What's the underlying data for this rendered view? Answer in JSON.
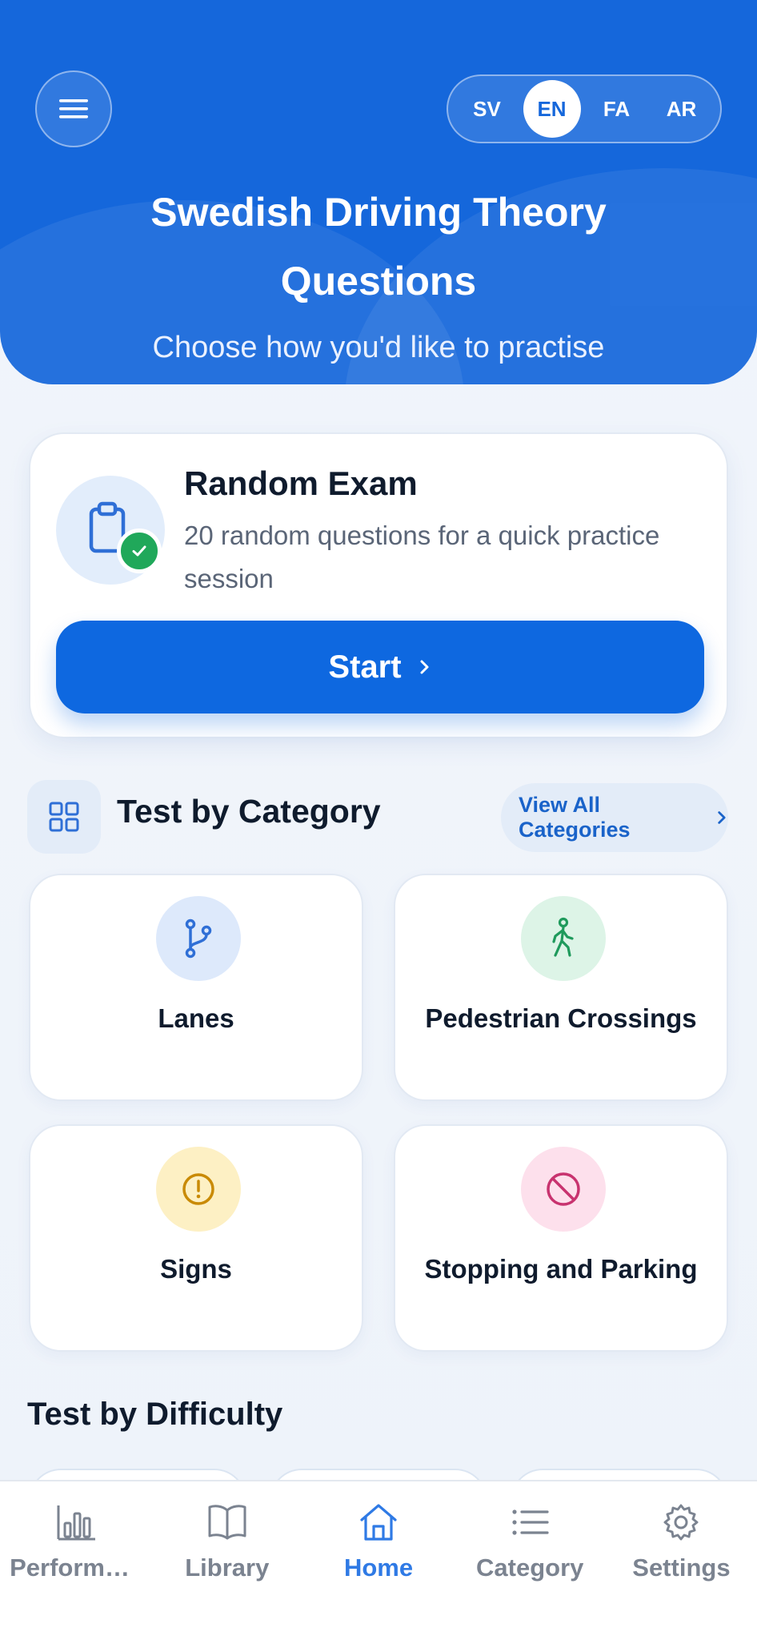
{
  "header": {
    "title_line1": "Swedish Driving Theory",
    "title_line2": "Questions",
    "subtitle": "Choose how you'd like to practise",
    "languages": [
      "SV",
      "EN",
      "FA",
      "AR"
    ],
    "active_language": "EN"
  },
  "exam": {
    "title": "Random Exam",
    "description": "20 random questions for a quick practice session",
    "start_label": "Start"
  },
  "categories": {
    "heading": "Test by Category",
    "view_all_label": "View All Categories",
    "items": [
      {
        "label": "Lanes",
        "icon": "lane-split-icon",
        "color": "#2f6fd6",
        "bg": "#dde9fb"
      },
      {
        "label": "Pedestrian Crossings",
        "icon": "pedestrian-icon",
        "color": "#1f9a5c",
        "bg": "#ddf4e7"
      },
      {
        "label": "Signs",
        "icon": "warning-icon",
        "color": "#c98a05",
        "bg": "#fdf0c4"
      },
      {
        "label": "Stopping and Parking",
        "icon": "no-entry-icon",
        "color": "#c8336f",
        "bg": "#fde0ec"
      }
    ]
  },
  "difficulty": {
    "heading": "Test by Difficulty"
  },
  "nav": {
    "items": [
      {
        "label": "Performa…",
        "icon": "bar-chart-icon"
      },
      {
        "label": "Library",
        "icon": "book-icon"
      },
      {
        "label": "Home",
        "icon": "home-icon"
      },
      {
        "label": "Category",
        "icon": "list-icon"
      },
      {
        "label": "Settings",
        "icon": "gear-icon"
      }
    ],
    "active": "Home"
  },
  "colors": {
    "primary": "#1567db",
    "button": "#0e68e0",
    "success": "#20a85a",
    "nav_active": "#2f7ae5",
    "nav_inactive": "#7b8390"
  }
}
